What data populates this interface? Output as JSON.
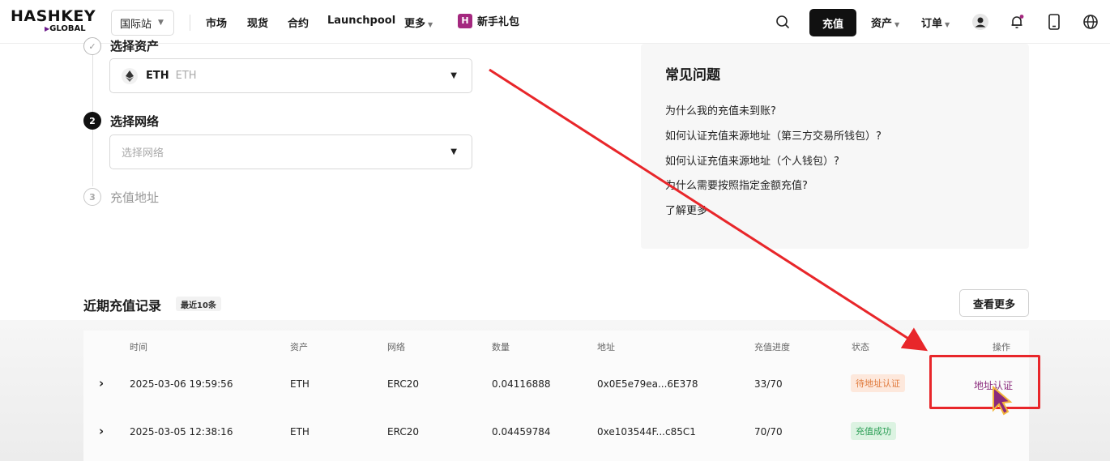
{
  "header": {
    "logo_main": "HASHKEY",
    "logo_sub": "GLOBAL",
    "site_select": "国际站",
    "nav": [
      "市场",
      "现货",
      "合约",
      "Launchpool",
      "更多"
    ],
    "gift": "新手礼包",
    "deposit": "充值",
    "assets": "资产",
    "orders": "订单"
  },
  "steps": {
    "step1_label": "选择资产",
    "asset_code": "ETH",
    "asset_name": "ETH",
    "step2_number": "2",
    "step2_label": "选择网络",
    "network_placeholder": "选择网络",
    "step3_number": "3",
    "step3_label": "充值地址"
  },
  "faq": {
    "title": "常见问题",
    "items": [
      "为什么我的充值未到账?",
      "如何认证充值来源地址（第三方交易所钱包）?",
      "如何认证充值来源地址（个人钱包）?",
      "为什么需要按照指定金额充值?",
      "了解更多"
    ]
  },
  "records": {
    "title": "近期充值记录",
    "badge": "最近10条",
    "more": "查看更多",
    "columns": [
      "时间",
      "资产",
      "网络",
      "数量",
      "地址",
      "充值进度",
      "状态",
      "操作"
    ],
    "rows": [
      {
        "time": "2025-03-06 19:59:56",
        "asset": "ETH",
        "network": "ERC20",
        "amount": "0.04116888",
        "address": "0x0E5e79ea...6E378",
        "progress": "33/70",
        "status": "待地址认证",
        "action": "地址认证"
      },
      {
        "time": "2025-03-05 12:38:16",
        "asset": "ETH",
        "network": "ERC20",
        "amount": "0.04459784",
        "address": "0xe103544F...c85C1",
        "progress": "70/70",
        "status": "充值成功",
        "action": ""
      }
    ]
  },
  "colors": {
    "accent": "#a4287f",
    "annotation": "#e8262a",
    "pending": "#e07a3c",
    "success": "#2c9e56"
  }
}
